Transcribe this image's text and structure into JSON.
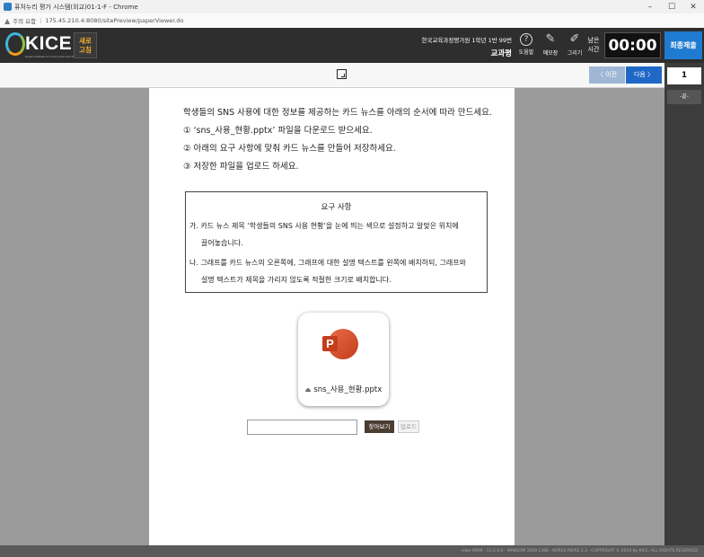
{
  "browser": {
    "window_title": "퓨처누리 평가 시스템(외교)01-1-F - Chrome",
    "security_label": "주의 요함",
    "url": "175.45.210.4:8080/sitePreview/paperViewer.do",
    "controls": [
      "–",
      "☐",
      "✕"
    ]
  },
  "header": {
    "logo_text": "KICE",
    "logo_subtext": "Korea Institute for Curriculum and Evaluation",
    "refresh_label_1": "새로",
    "refresh_label_2": "고침",
    "org_line": "한국교육과정평가원 1학년 1반 99번",
    "subject": "교과평",
    "tools": [
      {
        "icon": "question-icon",
        "glyph": "?",
        "label": "도움말"
      },
      {
        "icon": "memo-icon",
        "glyph": "✎",
        "label": "메모장"
      },
      {
        "icon": "draw-icon",
        "glyph": "✐",
        "label": "그리기"
      }
    ],
    "remain_label_1": "남은",
    "remain_label_2": "시간",
    "timer": "00:00",
    "submit_label": "최종제출"
  },
  "toolbar": {
    "fit_icon": "fit-screen-icon",
    "prev_label": "〈 이전",
    "next_label": "다음 〉"
  },
  "page_nav": {
    "current_page": "1",
    "end_label": "-끝-"
  },
  "question": {
    "lines": [
      "학생들의 SNS 사용에 대한 정보를 제공하는 카드 뉴스를 아래의 순서에 따라 만드세요.",
      "① ‘sns_사용_현황.pptx’ 파일을 다운로드 받으세요.",
      "② 아래의 요구 사항에 맞춰 카드 뉴스를 만들어 저장하세요.",
      "③ 저장한 파일을 업로드 하세요."
    ],
    "requirements": {
      "title": "요구 사항",
      "item_a_1": "가. 카드 뉴스 제목 ‘학생들의 SNS 사용 현황’을 눈에 띄는 색으로 설정하고 알맞은 위치에",
      "item_a_2": "끌어놓습니다.",
      "item_b_1": "나. 그래프를 카드 뉴스의 오른쪽에, 그래프에 대한 설명 텍스트를 왼쪽에 배치하되, 그래프와",
      "item_b_2": "설명 텍스트가 제목을 가리지 않도록 적절한 크기로 배치합니다."
    },
    "file": {
      "name": "sns_사용_현황.pptx",
      "icon": "powerpoint-icon"
    },
    "upload": {
      "input_value": "",
      "browse_label": "찾아보기",
      "upload_label": "업로드"
    }
  },
  "footer": {
    "text": "ssbo-0906 · 11.5.0.0 · WINDOW 1000 1386 · KOREA MORE 1.3 · COPYRIGHT © 2019 by KICE. ALL RIGHTS RESERVED."
  },
  "colors": {
    "header_bg": "#2e2e2e",
    "accent_blue": "#1f7bd1",
    "powerpoint": "#d35230"
  }
}
